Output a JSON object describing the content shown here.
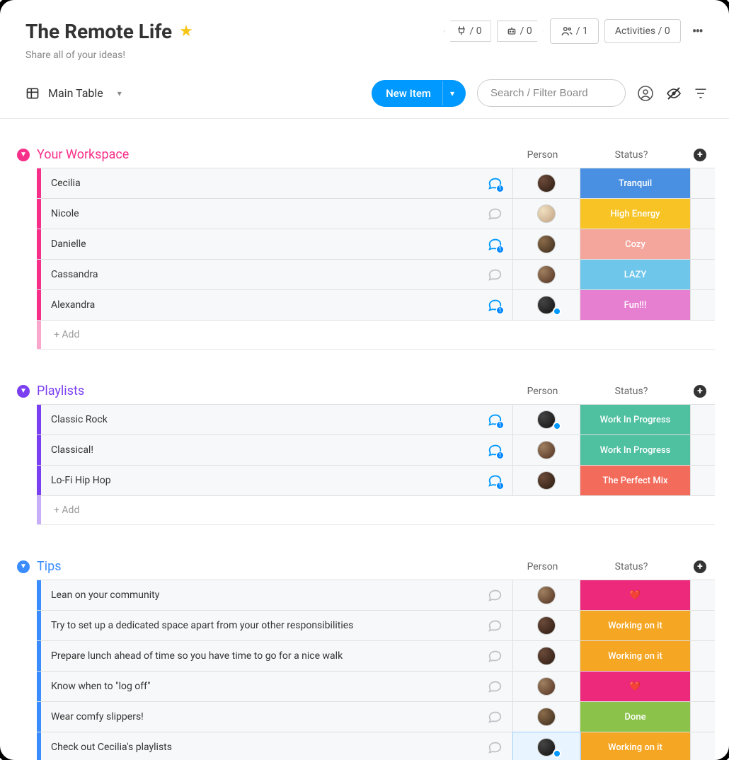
{
  "header": {
    "title": "The Remote Life",
    "subtitle": "Share all of your ideas!",
    "badges": {
      "integration_count": "/ 0",
      "automation_count": "/ 0",
      "members_count": "/ 1",
      "activities_label": "Activities / 0"
    }
  },
  "toolbar": {
    "view_name": "Main Table",
    "new_item_label": "New Item",
    "search_placeholder": "Search / Filter Board"
  },
  "columns": {
    "person": "Person",
    "status": "Status?"
  },
  "add_label": "+ Add",
  "groups": [
    {
      "id": "workspace",
      "title": "Your Workspace",
      "color": "#f6308a",
      "light_color": "#f9a7cd",
      "rows": [
        {
          "name": "Cecilia",
          "chat": true,
          "avatar": "a3",
          "pbadge": false,
          "status": "Tranquil",
          "status_color": "#4a90e2"
        },
        {
          "name": "Nicole",
          "chat": false,
          "avatar": "a2",
          "pbadge": false,
          "status": "High Energy",
          "status_color": "#f7c325"
        },
        {
          "name": "Danielle",
          "chat": true,
          "avatar": "a1",
          "pbadge": false,
          "status": "Cozy",
          "status_color": "#f4a59c"
        },
        {
          "name": "Cassandra",
          "chat": false,
          "avatar": "a5",
          "pbadge": false,
          "status": "LAZY",
          "status_color": "#6ec6eb"
        },
        {
          "name": "Alexandra",
          "chat": true,
          "avatar": "a4",
          "pbadge": true,
          "status": "Fun!!!",
          "status_color": "#e77fd1"
        }
      ]
    },
    {
      "id": "playlists",
      "title": "Playlists",
      "color": "#7b3ff2",
      "light_color": "#c7aef9",
      "rows": [
        {
          "name": "Classic Rock",
          "chat": true,
          "avatar": "a4",
          "pbadge": true,
          "status": "Work In Progress",
          "status_color": "#4fc0a0"
        },
        {
          "name": "Classical!",
          "chat": true,
          "avatar": "a5",
          "pbadge": false,
          "status": "Work In Progress",
          "status_color": "#4fc0a0"
        },
        {
          "name": "Lo-Fi Hip Hop",
          "chat": true,
          "avatar": "a3",
          "pbadge": false,
          "status": "The Perfect Mix",
          "status_color": "#f26b5b"
        }
      ]
    },
    {
      "id": "tips",
      "title": "Tips",
      "color": "#3b8cff",
      "light_color": "#a9ceff",
      "rows": [
        {
          "name": "Lean on your community",
          "chat": false,
          "avatar": "a5",
          "pbadge": false,
          "status": "❤️",
          "status_color": "#ec297b"
        },
        {
          "name": "Try to set up a dedicated space apart from your other responsibilities",
          "chat": false,
          "avatar": "a3",
          "pbadge": false,
          "status": "Working on it",
          "status_color": "#f5a623"
        },
        {
          "name": "Prepare lunch ahead of time so you have time to go for a nice walk",
          "chat": false,
          "avatar": "a3",
          "pbadge": false,
          "status": "Working on it",
          "status_color": "#f5a623"
        },
        {
          "name": "Know when to \"log off\"",
          "chat": false,
          "avatar": "a5",
          "pbadge": false,
          "status": "❤️",
          "status_color": "#ec297b"
        },
        {
          "name": "Wear comfy slippers!",
          "chat": false,
          "avatar": "a1",
          "pbadge": false,
          "status": "Done",
          "status_color": "#8bc34a"
        },
        {
          "name": "Check out Cecilia's playlists",
          "chat": false,
          "avatar": "a4",
          "pbadge": true,
          "selected": true,
          "status": "Working on it",
          "status_color": "#f5a623"
        }
      ]
    }
  ]
}
